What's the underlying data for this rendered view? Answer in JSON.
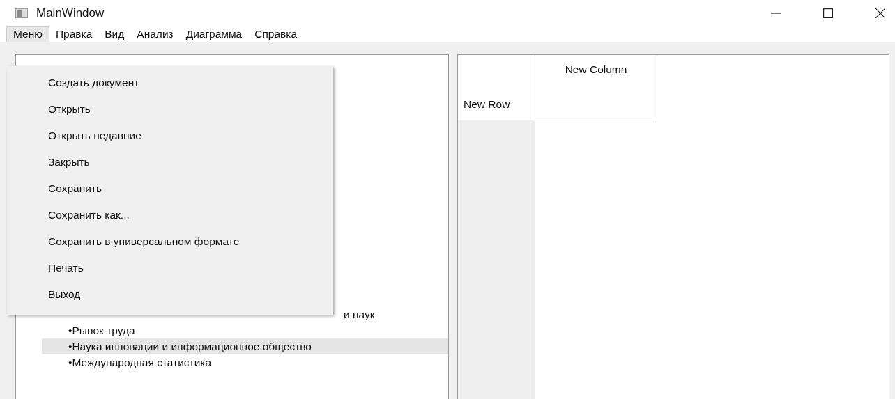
{
  "window": {
    "title": "MainWindow"
  },
  "menubar": [
    {
      "label": "Меню",
      "selected": true
    },
    {
      "label": "Правка",
      "selected": false
    },
    {
      "label": "Вид",
      "selected": false
    },
    {
      "label": "Анализ",
      "selected": false
    },
    {
      "label": "Диаграмма",
      "selected": false
    },
    {
      "label": "Справка",
      "selected": false
    }
  ],
  "dropdown": [
    "Создать документ",
    "Открыть",
    "Открыть недавние",
    "Закрыть",
    "Сохранить",
    "Сохранить как...",
    "Сохранить в универсальном формате",
    "Печать",
    "Выход"
  ],
  "list": [
    {
      "label": "и наук",
      "covered": true,
      "selected": false
    },
    {
      "label": "•Рынок труда",
      "covered": false,
      "selected": false
    },
    {
      "label": "•Наука инновации и информационное общество",
      "covered": false,
      "selected": true
    },
    {
      "label": "•Международная статистика",
      "covered": false,
      "selected": false
    }
  ],
  "table": {
    "row_header": "New Row",
    "column_header": "New Column"
  }
}
